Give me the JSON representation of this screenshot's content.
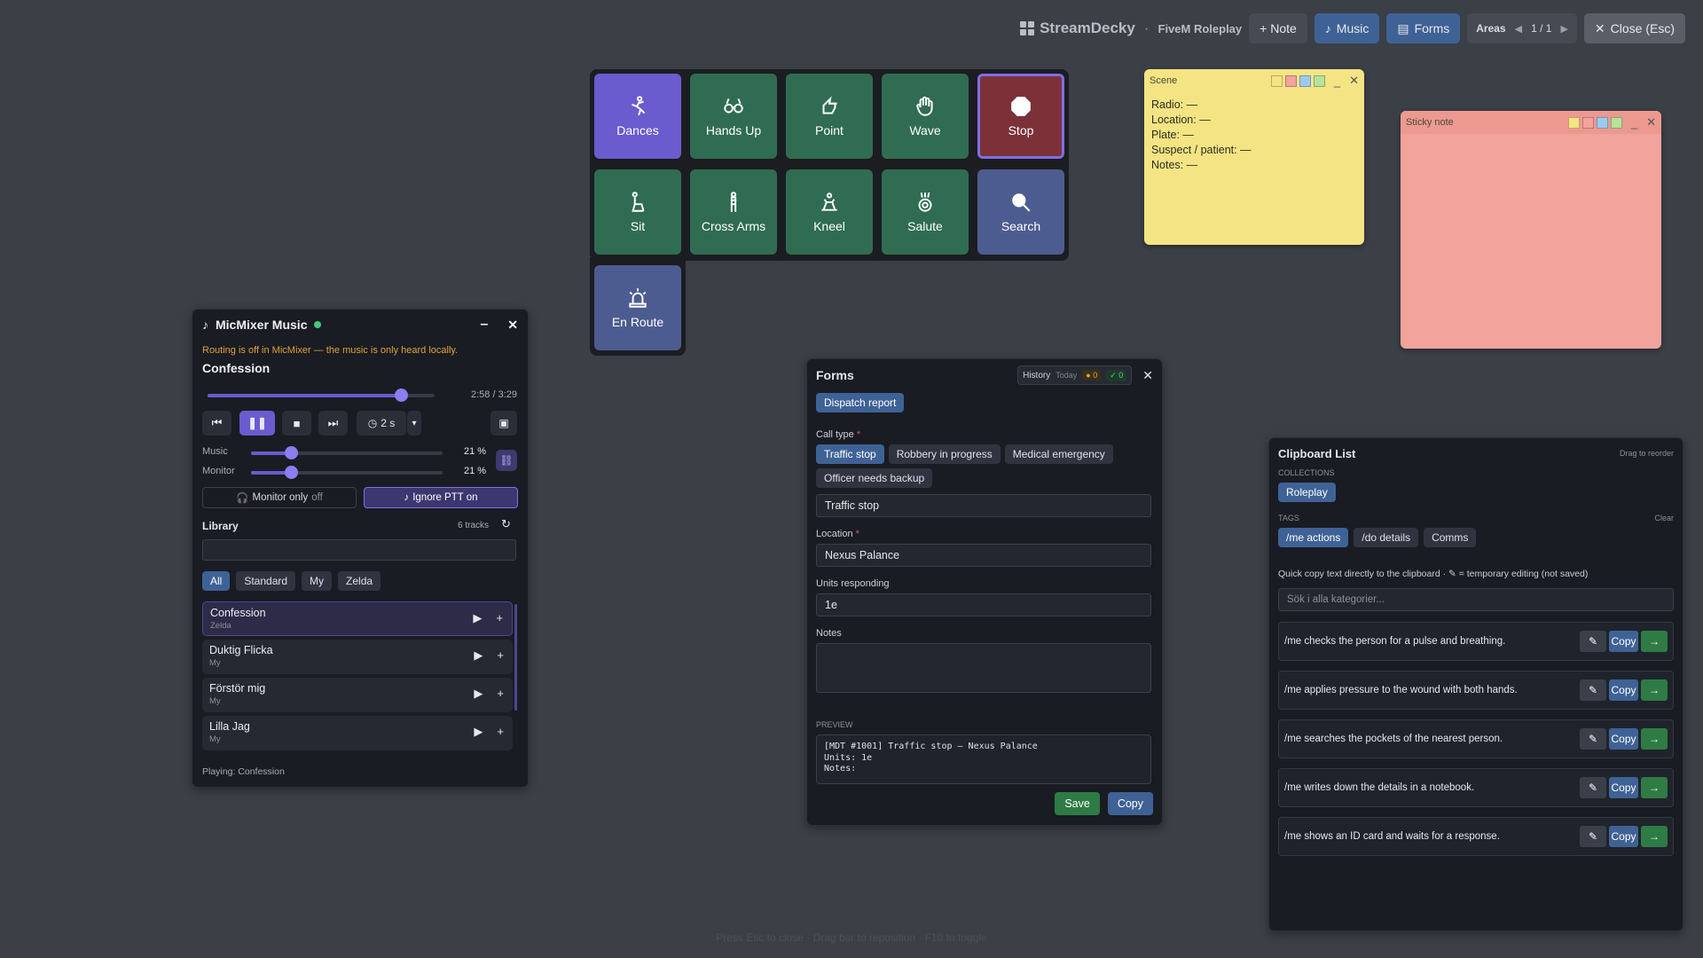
{
  "topbar": {
    "brand": "StreamDecky",
    "profile": "FiveM Roleplay",
    "note_label": "+ Note",
    "music_label": "Music",
    "forms_label": "Forms",
    "areas_label": "Areas",
    "areas_page": "1 / 1",
    "close_label": "Close (Esc)"
  },
  "deck": {
    "keys": [
      {
        "label": "Dances"
      },
      {
        "label": "Hands Up"
      },
      {
        "label": "Point"
      },
      {
        "label": "Wave"
      },
      {
        "label": "Stop"
      },
      {
        "label": "Sit"
      },
      {
        "label": "Cross Arms"
      },
      {
        "label": "Kneel"
      },
      {
        "label": "Salute"
      },
      {
        "label": "Search"
      },
      {
        "label": "En Route"
      }
    ]
  },
  "scene_note": {
    "title": "Scene",
    "lines": [
      "Radio: —",
      "Location: —",
      "Plate: —",
      "Suspect / patient: —",
      "Notes: —"
    ]
  },
  "sticky_note": {
    "title": "Sticky note"
  },
  "music": {
    "title": "MicMixer Music",
    "warning": "Routing is off in MicMixer — the music is only heard locally.",
    "track": "Confession",
    "time": "2:58 / 3:29",
    "progress": 0.85,
    "crossfade": "2 s",
    "music_label": "Music",
    "music_pct": "21 %",
    "monitor_label": "Monitor",
    "monitor_pct": "21 %",
    "volume_level": 0.21,
    "monitor_only": "Monitor only",
    "monitor_only_state": "off",
    "ignore_ptt": "Ignore PTT on",
    "library_label": "Library",
    "track_count": "6 tracks",
    "filters": [
      "All",
      "Standard",
      "My",
      "Zelda"
    ],
    "items": [
      {
        "name": "Confession",
        "source": "Zelda"
      },
      {
        "name": "Duktig Flicka",
        "source": "My"
      },
      {
        "name": "Förstör mig",
        "source": "My"
      },
      {
        "name": "Lilla Jag",
        "source": "My"
      }
    ],
    "playing": "Playing: Confession"
  },
  "forms": {
    "title": "Forms",
    "history": "History",
    "history_scope": "Today",
    "history_warn": "0",
    "history_ok": "0",
    "template": "Dispatch report",
    "call_type_label": "Call type",
    "call_types": [
      "Traffic stop",
      "Robbery in progress",
      "Medical emergency",
      "Officer needs backup"
    ],
    "call_type_value": "Traffic stop",
    "location_label": "Location",
    "location_value": "Nexus Palance",
    "units_label": "Units responding",
    "units_value": "1e",
    "notes_label": "Notes",
    "notes_value": "",
    "preview_label": "PREVIEW",
    "preview": "[MDT #1001] Traffic stop — Nexus Palance\nUnits: 1e\nNotes:",
    "save_label": "Save",
    "copy_label": "Copy"
  },
  "clipboard": {
    "title": "Clipboard List",
    "drag_hint": "Drag to reorder",
    "collections_label": "COLLECTIONS",
    "collection": "Roleplay",
    "tags_label": "TAGS",
    "clear_label": "Clear",
    "tags": [
      "/me actions",
      "/do details",
      "Comms"
    ],
    "info": "Quick copy text directly to the clipboard · ✎ = temporary editing (not saved)",
    "search_placeholder": "Sök i alla kategorier...",
    "copy_label": "Copy",
    "items": [
      "/me checks the person for a pulse and breathing.",
      "/me applies pressure to the wound with both hands.",
      "/me searches the pockets of the nearest person.",
      "/me writes down the details in a notebook.",
      "/me shows an ID card and waits for a response."
    ]
  },
  "footer_hint": "Press Esc to close · Drag bar to reposition · F10 to toggle",
  "colors": {
    "background": "#3b3f46",
    "accent_purple": "#6a5bcf",
    "key_green": "#2f6c52",
    "brand_blue": "#3f6296",
    "scene_note": "#f4e483",
    "sticky_note": "#f2a39c"
  }
}
